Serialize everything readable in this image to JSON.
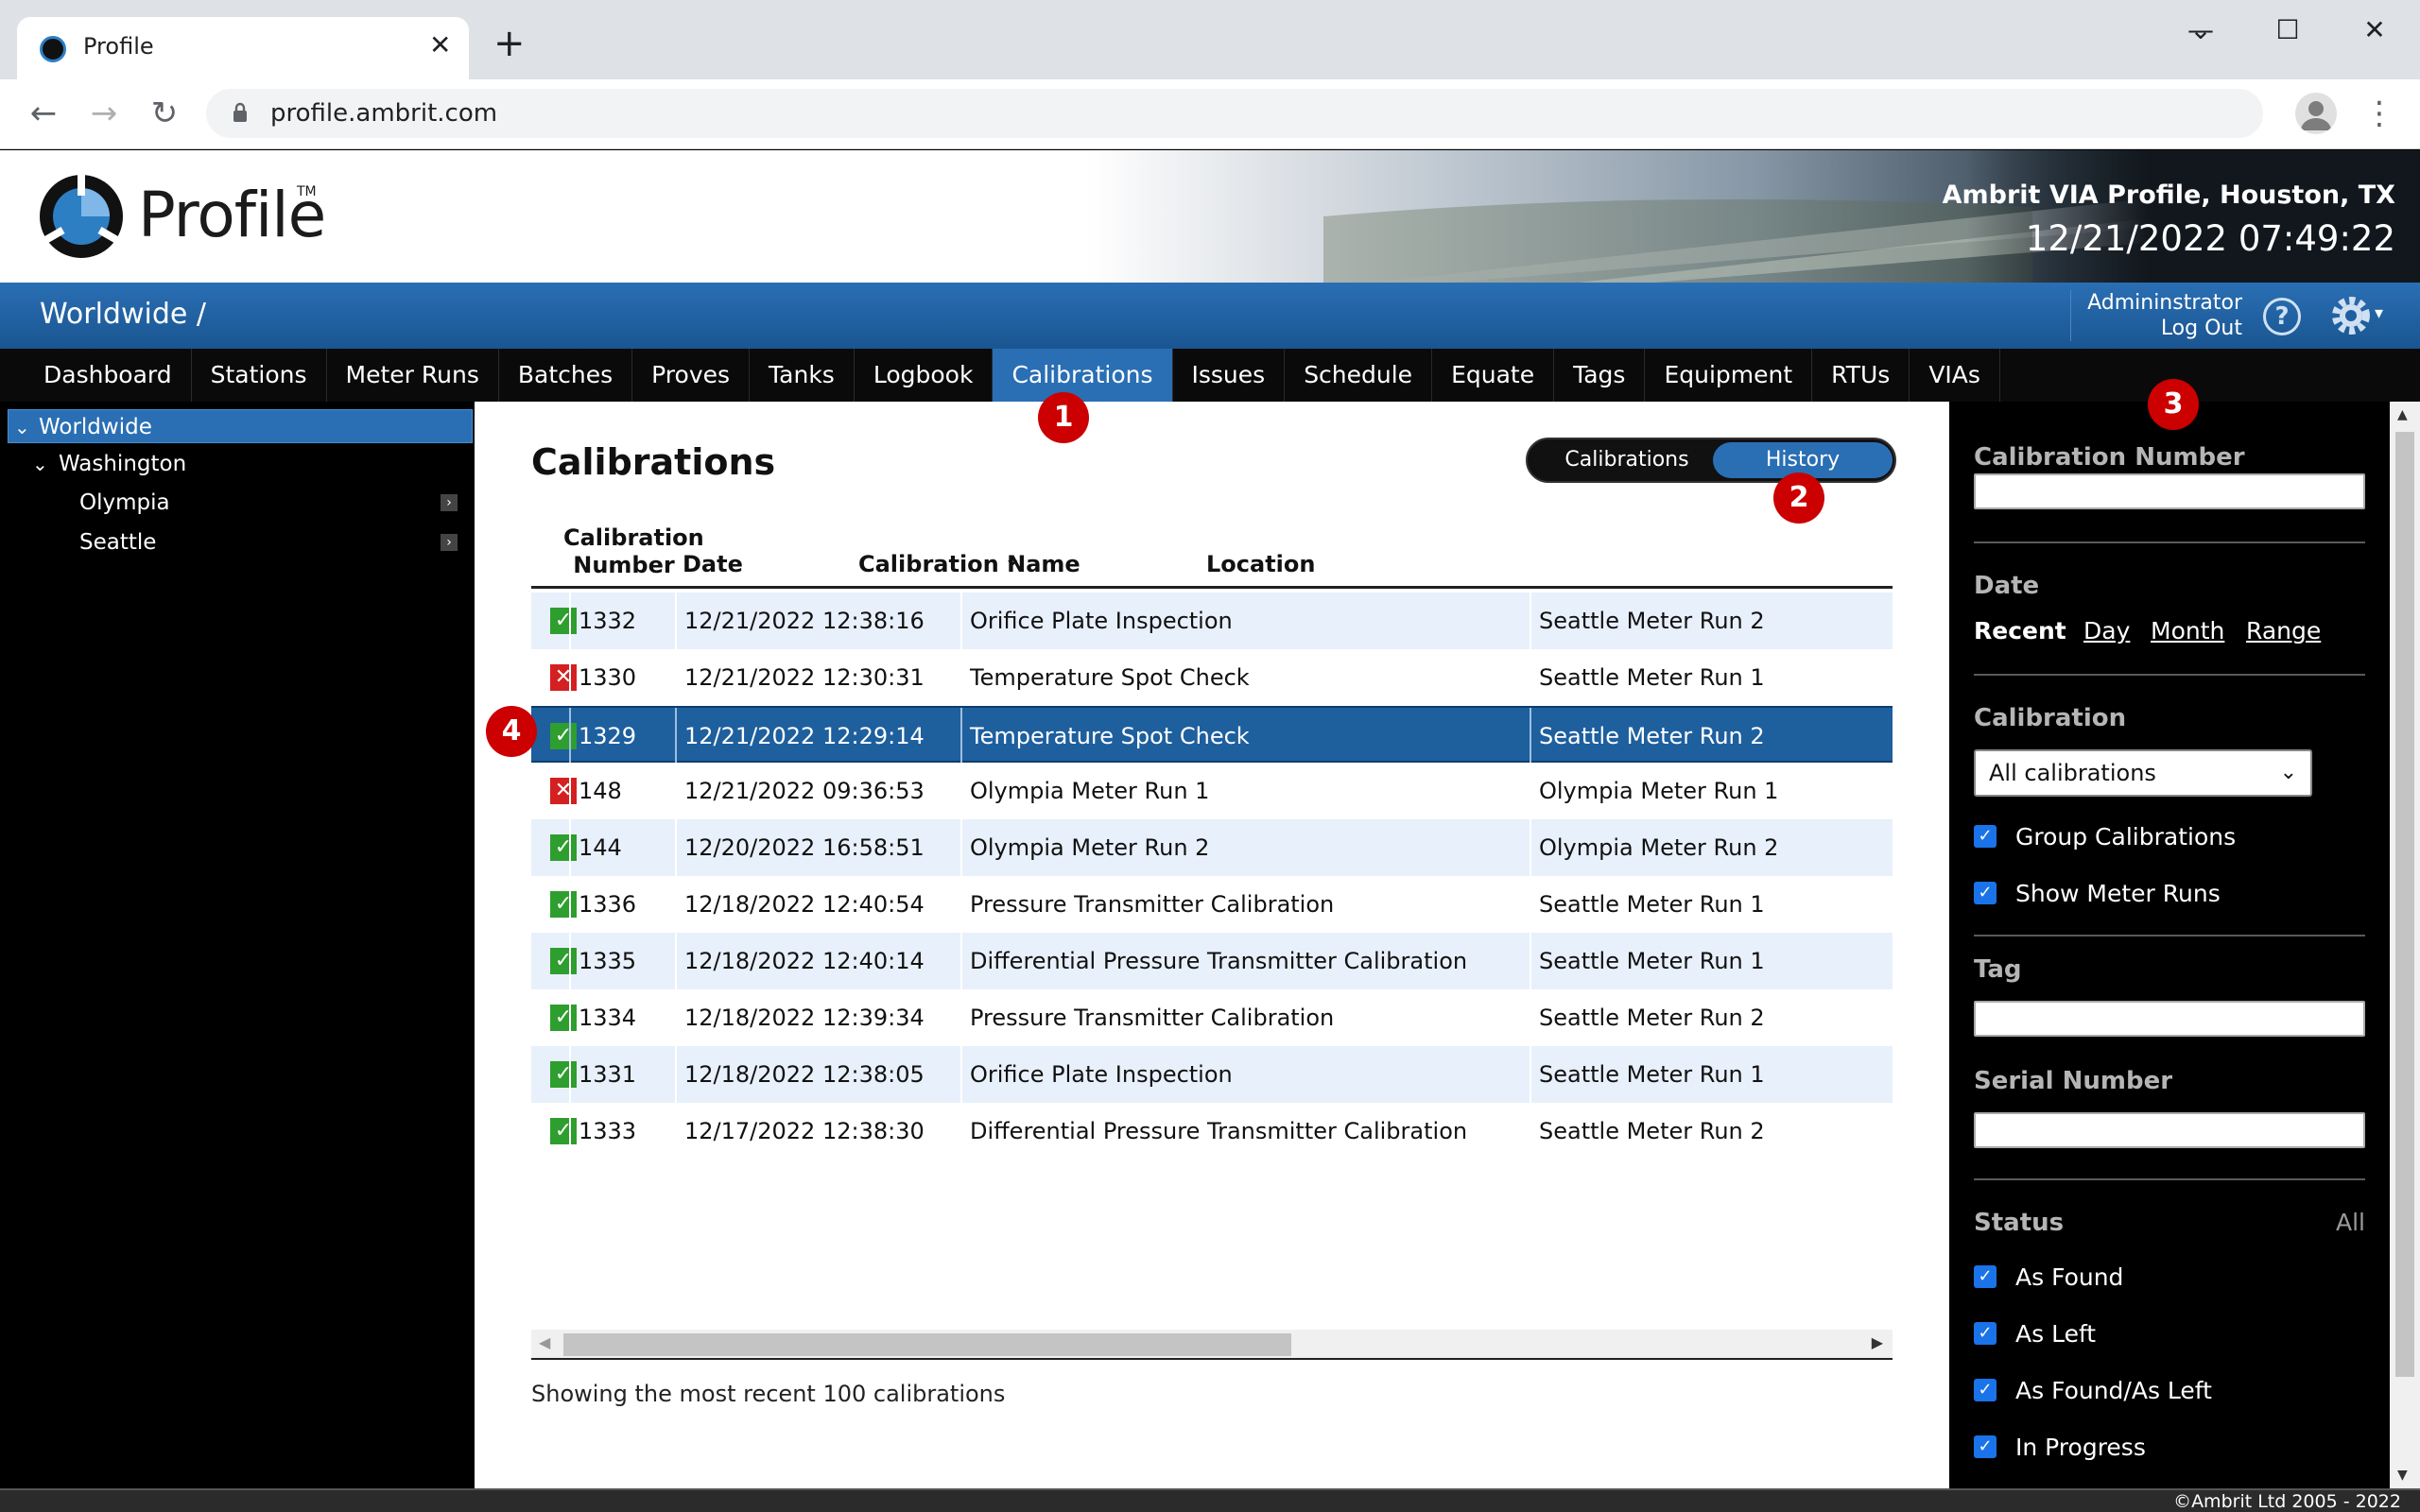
{
  "browser": {
    "tab_title": "Profile",
    "tab_close": "✕",
    "new_tab": "+",
    "url": "profile.ambrit.com",
    "win_min": "⌄",
    "win_minimize": "—",
    "win_max": "☐",
    "win_close": "✕",
    "back": "←",
    "forward": "→",
    "reload": "↻",
    "menu": "⋮"
  },
  "header": {
    "logo": "Profile",
    "logo_tm": "TM",
    "site_name": "Ambrit VIA Profile, Houston, TX",
    "clock": "12/21/2022 07:49:22"
  },
  "bluebar": {
    "breadcrumb": "Worldwide /",
    "user": "Admininstrator",
    "logout": "Log Out",
    "help": "?",
    "gear_caret": "▾"
  },
  "nav": [
    {
      "label": "Dashboard",
      "active": false
    },
    {
      "label": "Stations",
      "active": false
    },
    {
      "label": "Meter Runs",
      "active": false
    },
    {
      "label": "Batches",
      "active": false
    },
    {
      "label": "Proves",
      "active": false
    },
    {
      "label": "Tanks",
      "active": false
    },
    {
      "label": "Logbook",
      "active": false
    },
    {
      "label": "Calibrations",
      "active": true
    },
    {
      "label": "Issues",
      "active": false
    },
    {
      "label": "Schedule",
      "active": false
    },
    {
      "label": "Equate",
      "active": false
    },
    {
      "label": "Tags",
      "active": false
    },
    {
      "label": "Equipment",
      "active": false
    },
    {
      "label": "RTUs",
      "active": false
    },
    {
      "label": "VIAs",
      "active": false
    }
  ],
  "tree": {
    "root": "Worldwide",
    "region": "Washington",
    "sites": [
      "Olympia",
      "Seattle"
    ],
    "chev": "⌄",
    "arrow": "›"
  },
  "content": {
    "title": "Calibrations",
    "toggle": {
      "left": "Calibrations",
      "right": "History"
    },
    "columns": {
      "number_line1": "Calibration",
      "number_line2": "Number",
      "date": "Date",
      "sort_icon": "⌄",
      "name": "Calibration Name",
      "location": "Location"
    },
    "rows": [
      {
        "status": "pass",
        "icon": "✓",
        "number": "1332",
        "date": "12/21/2022 12:38:16",
        "name": "Orifice Plate Inspection",
        "location": "Seattle Meter Run 2"
      },
      {
        "status": "fail",
        "icon": "✕",
        "number": "1330",
        "date": "12/21/2022 12:30:31",
        "name": "Temperature Spot Check",
        "location": "Seattle Meter Run 1"
      },
      {
        "status": "pass",
        "icon": "✓",
        "number": "1329",
        "date": "12/21/2022 12:29:14",
        "name": "Temperature Spot Check",
        "location": "Seattle Meter Run 2"
      },
      {
        "status": "fail",
        "icon": "✕",
        "number": "148",
        "date": "12/21/2022 09:36:53",
        "name": "Olympia Meter Run 1",
        "location": "Olympia Meter Run 1"
      },
      {
        "status": "pass",
        "icon": "✓",
        "number": "144",
        "date": "12/20/2022 16:58:51",
        "name": "Olympia Meter Run 2",
        "location": "Olympia Meter Run 2"
      },
      {
        "status": "pass",
        "icon": "✓",
        "number": "1336",
        "date": "12/18/2022 12:40:54",
        "name": "Pressure Transmitter Calibration",
        "location": "Seattle Meter Run 1"
      },
      {
        "status": "pass",
        "icon": "✓",
        "number": "1335",
        "date": "12/18/2022 12:40:14",
        "name": "Differential Pressure Transmitter Calibration",
        "location": "Seattle Meter Run 1"
      },
      {
        "status": "pass",
        "icon": "✓",
        "number": "1334",
        "date": "12/18/2022 12:39:34",
        "name": "Pressure Transmitter Calibration",
        "location": "Seattle Meter Run 2"
      },
      {
        "status": "pass",
        "icon": "✓",
        "number": "1331",
        "date": "12/18/2022 12:38:05",
        "name": "Orifice Plate Inspection",
        "location": "Seattle Meter Run 1"
      },
      {
        "status": "pass",
        "icon": "✓",
        "number": "1333",
        "date": "12/17/2022 12:38:30",
        "name": "Differential Pressure Transmitter Calibration",
        "location": "Seattle Meter Run 2"
      }
    ],
    "selected_row": 2,
    "scroll_left": "◀",
    "scroll_right": "▶",
    "footer": "Showing the most recent 100 calibrations"
  },
  "filters": {
    "calibration_number_label": "Calibration Number",
    "date_label": "Date",
    "date_options": [
      "Recent",
      "Day",
      "Month",
      "Range"
    ],
    "calibration_label": "Calibration",
    "calibration_value": "All calibrations",
    "select_caret": "⌄",
    "group_calibrations": "Group Calibrations",
    "show_meter_runs": "Show Meter Runs",
    "tag_label": "Tag",
    "serial_number_label": "Serial Number",
    "status_label": "Status",
    "status_all": "All",
    "statuses": [
      "As Found",
      "As Left",
      "As Found/As Left",
      "In Progress"
    ],
    "check": "✓",
    "scroll_up": "▲",
    "scroll_down": "▼"
  },
  "markers": [
    "1",
    "2",
    "3",
    "4"
  ],
  "footer": {
    "copyright": "©Ambrit Ltd 2005 - 2022"
  },
  "colors": {
    "brand_blue": "#2a6fb4",
    "selected_row": "#1e5f9e",
    "alt_row": "#e8f0fb",
    "pass": "#2e9e2e",
    "fail": "#d42020",
    "marker": "#cc0000"
  }
}
